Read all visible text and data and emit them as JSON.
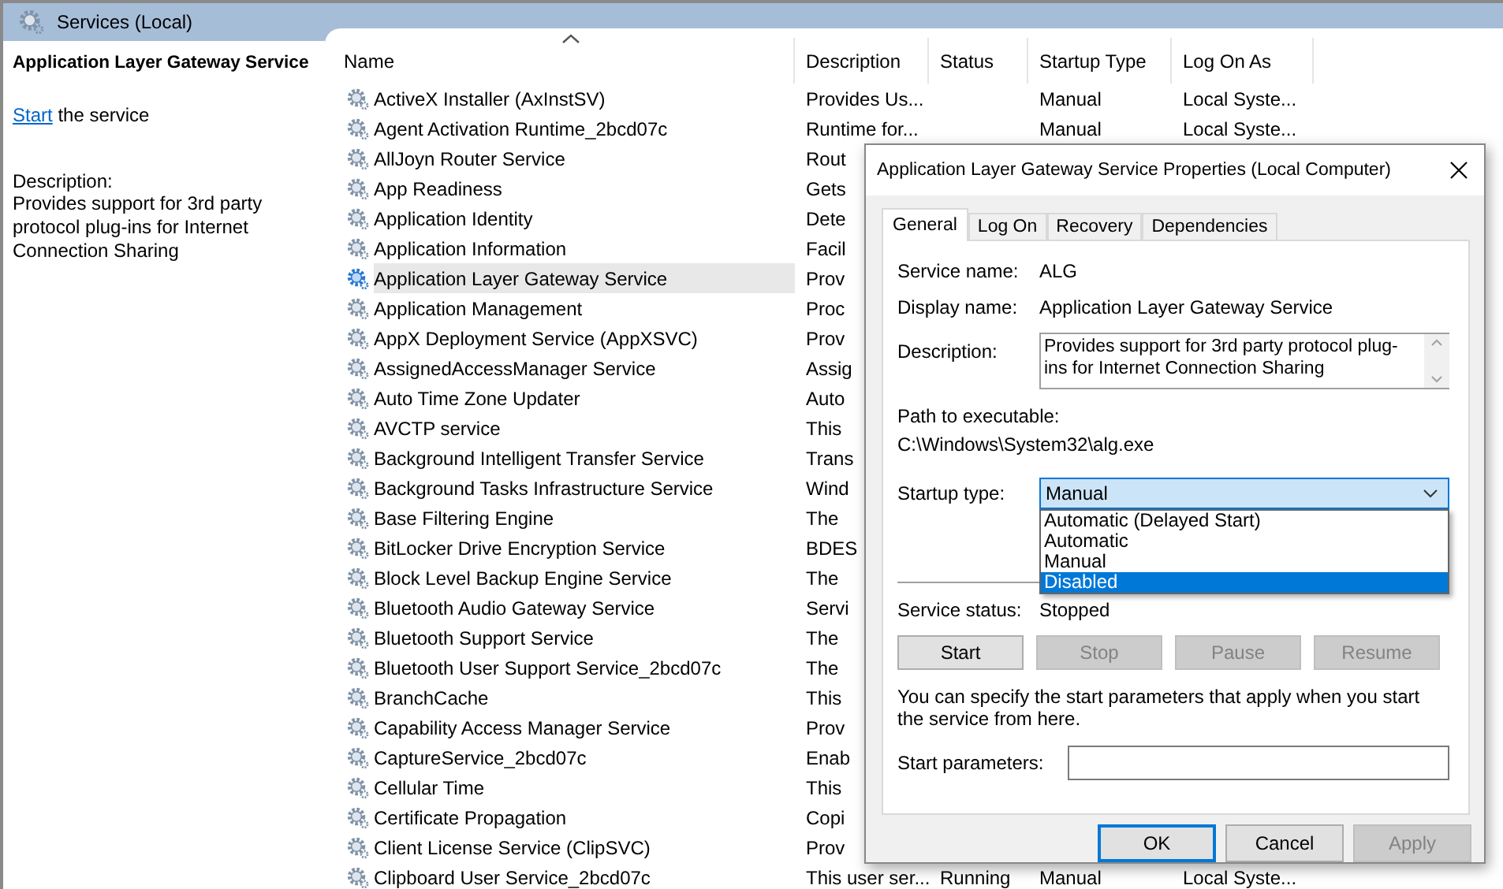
{
  "window": {
    "title": "Services (Local)"
  },
  "details": {
    "title": "Application Layer Gateway Service",
    "action_link": "Start",
    "action_text": "the service",
    "description_label": "Description:",
    "description": "Provides support for 3rd party protocol plug-ins for Internet Connection Sharing"
  },
  "table": {
    "columns": [
      "Name",
      "Description",
      "Status",
      "Startup Type",
      "Log On As"
    ],
    "rows": [
      {
        "name": "ActiveX Installer (AxInstSV)",
        "description": "Provides Us...",
        "startup_type": "Manual",
        "log_on_as": "Local Syste...",
        "selected": false
      },
      {
        "name": "Agent Activation Runtime_2bcd07c",
        "description": "Runtime for...",
        "startup_type": "Manual",
        "log_on_as": "Local Syste...",
        "selected": false
      },
      {
        "name": "AllJoyn Router Service",
        "description": "Rout",
        "selected": false
      },
      {
        "name": "App Readiness",
        "description": "Gets",
        "selected": false
      },
      {
        "name": "Application Identity",
        "description": "Dete",
        "selected": false
      },
      {
        "name": "Application Information",
        "description": "Facil",
        "selected": false
      },
      {
        "name": "Application Layer Gateway Service",
        "description": "Prov",
        "selected": true
      },
      {
        "name": "Application Management",
        "description": "Proc",
        "selected": false
      },
      {
        "name": "AppX Deployment Service (AppXSVC)",
        "description": "Prov",
        "selected": false
      },
      {
        "name": "AssignedAccessManager Service",
        "description": "Assig",
        "selected": false
      },
      {
        "name": "Auto Time Zone Updater",
        "description": "Auto",
        "selected": false
      },
      {
        "name": "AVCTP service",
        "description": "This",
        "selected": false
      },
      {
        "name": "Background Intelligent Transfer Service",
        "description": "Trans",
        "selected": false
      },
      {
        "name": "Background Tasks Infrastructure Service",
        "description": "Wind",
        "selected": false
      },
      {
        "name": "Base Filtering Engine",
        "description": "The",
        "selected": false
      },
      {
        "name": "BitLocker Drive Encryption Service",
        "description": "BDES",
        "selected": false
      },
      {
        "name": "Block Level Backup Engine Service",
        "description": "The",
        "selected": false
      },
      {
        "name": "Bluetooth Audio Gateway Service",
        "description": "Servi",
        "selected": false
      },
      {
        "name": "Bluetooth Support Service",
        "description": "The",
        "selected": false
      },
      {
        "name": "Bluetooth User Support Service_2bcd07c",
        "description": "The",
        "selected": false
      },
      {
        "name": "BranchCache",
        "description": "This",
        "selected": false
      },
      {
        "name": "Capability Access Manager Service",
        "description": "Prov",
        "selected": false
      },
      {
        "name": "CaptureService_2bcd07c",
        "description": "Enab",
        "selected": false
      },
      {
        "name": "Cellular Time",
        "description": "This",
        "selected": false
      },
      {
        "name": "Certificate Propagation",
        "description": "Copi",
        "selected": false
      },
      {
        "name": "Client License Service (ClipSVC)",
        "description": "Prov",
        "selected": false
      },
      {
        "name": "Clipboard User Service_2bcd07c",
        "description": "This user ser...",
        "status": "Running",
        "startup_type": "Manual",
        "log_on_as": "Local Syste...",
        "selected": false
      }
    ]
  },
  "dialog": {
    "title": "Application Layer Gateway Service Properties (Local Computer)",
    "tabs": [
      {
        "label": "General",
        "selected": true
      },
      {
        "label": "Log On",
        "selected": false
      },
      {
        "label": "Recovery",
        "selected": false
      },
      {
        "label": "Dependencies",
        "selected": false
      }
    ],
    "service_name": {
      "label": "Service name:",
      "value": "ALG"
    },
    "display_name": {
      "label": "Display name:",
      "value": "Application Layer Gateway Service"
    },
    "description": {
      "label": "Description:",
      "value": "Provides support for 3rd party protocol plug-ins for Internet Connection Sharing"
    },
    "path": {
      "label": "Path to executable:",
      "value": "C:\\Windows\\System32\\alg.exe"
    },
    "startup_type": {
      "label": "Startup type:",
      "value": "Manual",
      "expanded": true,
      "options": [
        {
          "label": "Automatic (Delayed Start)",
          "highlighted": false
        },
        {
          "label": "Automatic",
          "highlighted": false
        },
        {
          "label": "Manual",
          "highlighted": false
        },
        {
          "label": "Disabled",
          "highlighted": true
        }
      ]
    },
    "service_status": {
      "label": "Service status:",
      "value": "Stopped"
    },
    "control_buttons": [
      {
        "label": "Start",
        "disabled": false
      },
      {
        "label": "Stop",
        "disabled": true
      },
      {
        "label": "Pause",
        "disabled": true
      },
      {
        "label": "Resume",
        "disabled": true
      }
    ],
    "hint": "You can specify the start parameters that apply when you start the service from here.",
    "start_parameters": {
      "label": "Start parameters:"
    },
    "buttons": [
      {
        "label": "OK",
        "default": true,
        "disabled": false
      },
      {
        "label": "Cancel",
        "default": false,
        "disabled": false
      },
      {
        "label": "Apply",
        "default": false,
        "disabled": true
      }
    ]
  }
}
